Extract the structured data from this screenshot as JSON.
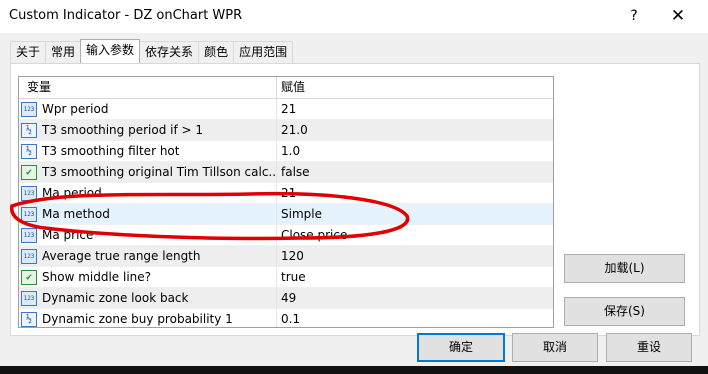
{
  "window": {
    "title": "Custom Indicator - DZ onChart WPR",
    "help_label": "?",
    "close_label": "✕"
  },
  "tabs": [
    {
      "label": "关于"
    },
    {
      "label": "常用"
    },
    {
      "label": "输入参数"
    },
    {
      "label": "依存关系"
    },
    {
      "label": "颜色"
    },
    {
      "label": "应用范围"
    }
  ],
  "active_tab": "输入参数",
  "grid": {
    "headers": {
      "variable": "变量",
      "value": "赋值"
    },
    "rows": [
      {
        "icon": "int-icon",
        "icon_text": "123",
        "name": "Wpr period",
        "value": "21"
      },
      {
        "icon": "double-icon",
        "icon_text": "½",
        "name": "T3 smoothing period if > 1",
        "value": "21.0"
      },
      {
        "icon": "double-icon",
        "icon_text": "½",
        "name": "T3 smoothing filter hot",
        "value": "1.0"
      },
      {
        "icon": "bool-icon",
        "icon_text": "✔",
        "name": "T3 smoothing original Tim Tillson calc...",
        "value": "false"
      },
      {
        "icon": "int-icon",
        "icon_text": "123",
        "name": "Ma period",
        "value": "21"
      },
      {
        "icon": "int-icon",
        "icon_text": "123",
        "name": "Ma method",
        "value": "Simple"
      },
      {
        "icon": "int-icon",
        "icon_text": "123",
        "name": "Ma price",
        "value": "Close price"
      },
      {
        "icon": "int-icon",
        "icon_text": "123",
        "name": "Average true range length",
        "value": "120"
      },
      {
        "icon": "bool-icon",
        "icon_text": "✔",
        "name": "Show middle line?",
        "value": "true"
      },
      {
        "icon": "int-icon",
        "icon_text": "123",
        "name": "Dynamic zone look back",
        "value": "49"
      },
      {
        "icon": "double-icon",
        "icon_text": "½",
        "name": "Dynamic zone buy probability 1",
        "value": "0.1"
      }
    ],
    "selected_row": 5
  },
  "side_buttons": {
    "load_label": "加载(L)",
    "save_label": "保存(S)"
  },
  "footer_buttons": {
    "ok_label": "确定",
    "cancel_label": "取消",
    "reset_label": "重设"
  },
  "colors": {
    "selection": "#e5f3ff",
    "default_button_border": "#0078d7",
    "annotation_stroke": "#e00000"
  }
}
